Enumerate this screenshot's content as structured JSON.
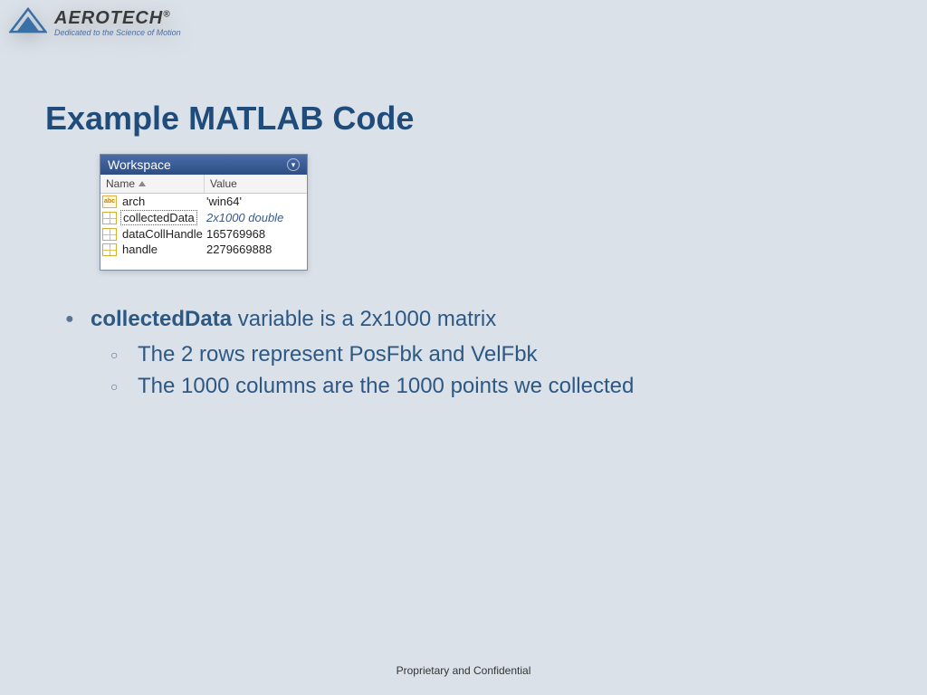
{
  "logo": {
    "brand": "AEROTECH",
    "reg": "®",
    "tagline": "Dedicated to the Science of Motion"
  },
  "title": "Example MATLAB Code",
  "workspace": {
    "panel_title": "Workspace",
    "columns": {
      "name": "Name",
      "value": "Value"
    },
    "rows": [
      {
        "icon": "abc",
        "name": "arch",
        "value": "'win64'",
        "italic": false,
        "selected": false
      },
      {
        "icon": "grid",
        "name": "collectedData",
        "value": "2x1000 double",
        "italic": true,
        "selected": true
      },
      {
        "icon": "grid",
        "name": "dataCollHandle",
        "value": "165769968",
        "italic": false,
        "selected": false
      },
      {
        "icon": "grid",
        "name": "handle",
        "value": "2279669888",
        "italic": false,
        "selected": false
      }
    ]
  },
  "bullets": {
    "main_bold": "collectedData",
    "main_rest": " variable is a 2x1000 matrix",
    "sub1": "The 2 rows represent PosFbk and VelFbk",
    "sub2": "The 1000 columns are the 1000 points we collected"
  },
  "footer": "Proprietary and Confidential"
}
